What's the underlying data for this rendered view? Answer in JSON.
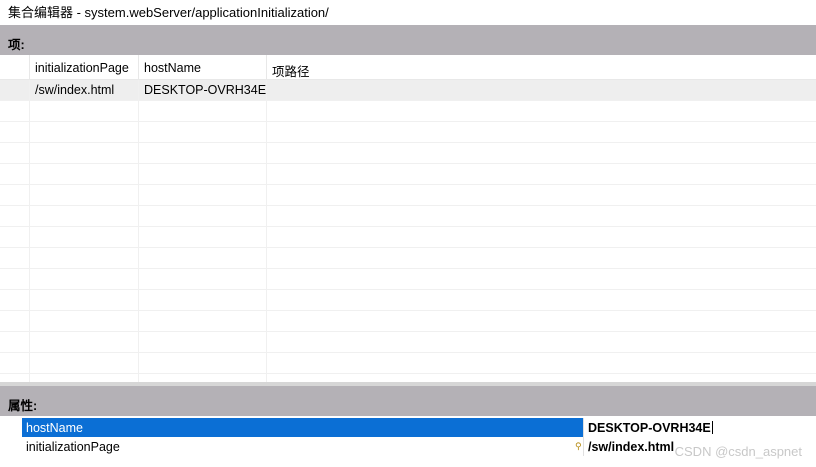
{
  "title": "集合编辑器 - system.webServer/applicationInitialization/",
  "items_section": {
    "label": "项:"
  },
  "grid": {
    "columns": [
      "initializationPage",
      "hostName",
      "项路径"
    ],
    "rows": [
      {
        "initializationPage": "/sw/index.html",
        "hostName": "DESKTOP-OVRH34E",
        "item_path": ""
      }
    ]
  },
  "properties_section": {
    "label": "属性:"
  },
  "properties": [
    {
      "name": "hostName",
      "value": "DESKTOP-OVRH34E",
      "selected": true,
      "is_key": false
    },
    {
      "name": "initializationPage",
      "value": "/sw/index.html",
      "selected": false,
      "is_key": true
    }
  ],
  "icons": {
    "key": "key-icon"
  },
  "colors": {
    "section_header": "#b4b1b6",
    "selection": "#0b6fd5"
  },
  "watermark": "CSDN @csdn_aspnet"
}
